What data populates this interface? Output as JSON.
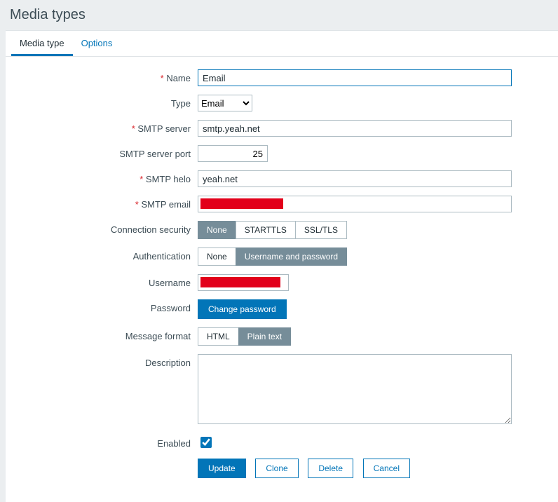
{
  "header": {
    "title": "Media types"
  },
  "tabs": {
    "media_type": "Media type",
    "options": "Options",
    "active": "media_type"
  },
  "form": {
    "name": {
      "label": "Name",
      "value": "Email"
    },
    "type": {
      "label": "Type",
      "value": "Email"
    },
    "smtp_server": {
      "label": "SMTP server",
      "value": "smtp.yeah.net"
    },
    "smtp_port": {
      "label": "SMTP server port",
      "value": "25"
    },
    "smtp_helo": {
      "label": "SMTP helo",
      "value": "yeah.net"
    },
    "smtp_email": {
      "label": "SMTP email",
      "value": ""
    },
    "conn_sec": {
      "label": "Connection security",
      "options": [
        "None",
        "STARTTLS",
        "SSL/TLS"
      ],
      "selected": "None"
    },
    "auth": {
      "label": "Authentication",
      "options": [
        "None",
        "Username and password"
      ],
      "selected": "Username and password"
    },
    "username": {
      "label": "Username",
      "value": ""
    },
    "password": {
      "label": "Password",
      "button": "Change password"
    },
    "msg_format": {
      "label": "Message format",
      "options": [
        "HTML",
        "Plain text"
      ],
      "selected": "Plain text"
    },
    "description": {
      "label": "Description",
      "value": ""
    },
    "enabled": {
      "label": "Enabled",
      "checked": true
    }
  },
  "actions": {
    "update": "Update",
    "clone": "Clone",
    "delete": "Delete",
    "cancel": "Cancel"
  }
}
